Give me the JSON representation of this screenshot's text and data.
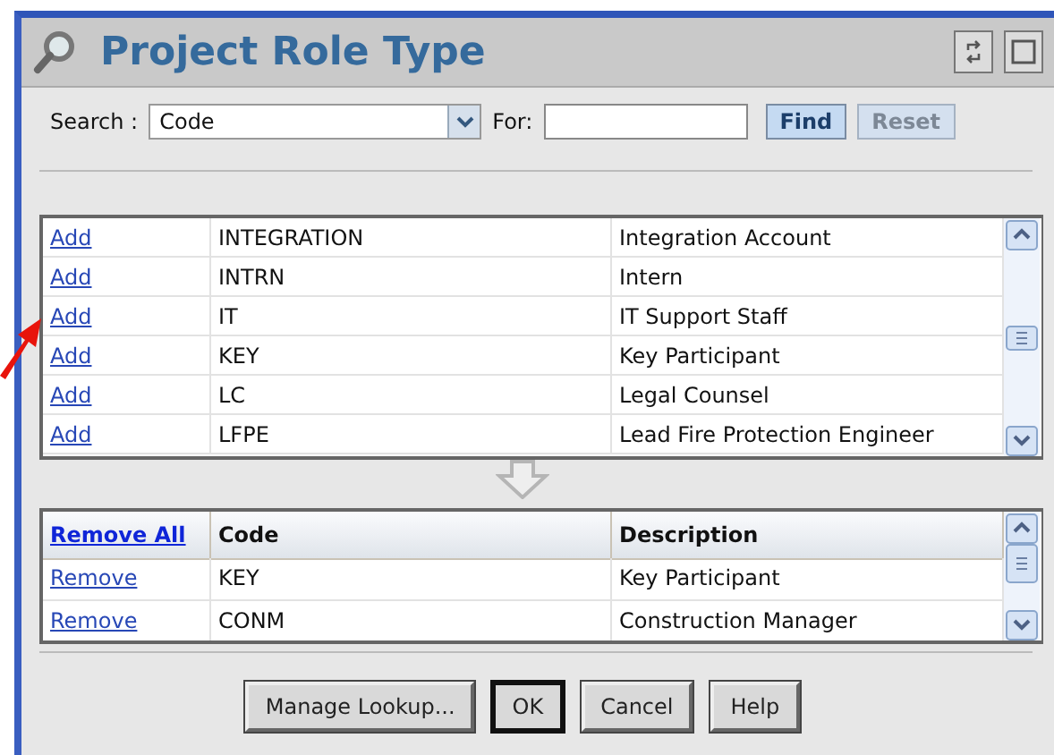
{
  "window": {
    "title": "Project Role Type"
  },
  "search": {
    "label": "Search :",
    "field": {
      "value": "Code"
    },
    "for_label": "For:",
    "buttons": [
      {
        "label": "Find",
        "disabled": false
      },
      {
        "label": "Reset",
        "disabled": true
      }
    ]
  },
  "available": {
    "rows": [
      {
        "action": "Add",
        "code": "INTEGRATION",
        "description": "Integration Account"
      },
      {
        "action": "Add",
        "code": "INTRN",
        "description": "Intern"
      },
      {
        "action": "Add",
        "code": "IT",
        "description": "IT Support Staff"
      },
      {
        "action": "Add",
        "code": "KEY",
        "description": "Key Participant"
      },
      {
        "action": "Add",
        "code": "LC",
        "description": "Legal Counsel"
      },
      {
        "action": "Add",
        "code": "LFPE",
        "description": "Lead Fire Protection Engineer"
      }
    ]
  },
  "selected_list": {
    "columns": [
      "Remove All",
      "Code",
      "Description"
    ],
    "rows": [
      {
        "action": "Remove",
        "code": "KEY",
        "description": "Key Participant"
      },
      {
        "action": "Remove",
        "code": "CONM",
        "description": "Construction Manager"
      }
    ]
  },
  "buttons": [
    {
      "label": "Manage Lookup...",
      "default": false
    },
    {
      "label": "OK",
      "default": true
    },
    {
      "label": "Cancel",
      "default": false
    },
    {
      "label": "Help",
      "default": false
    }
  ]
}
